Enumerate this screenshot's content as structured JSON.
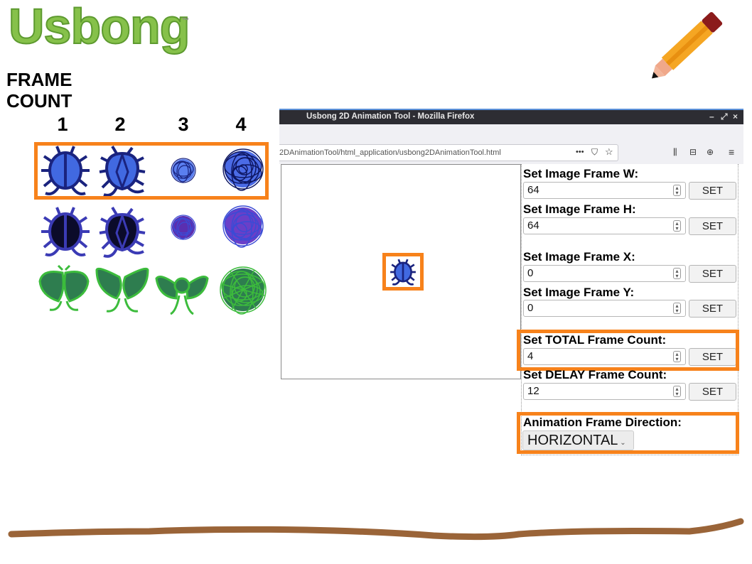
{
  "logo": {
    "text": "Usbong",
    "trademark": "™"
  },
  "heading": {
    "line1": "FRAME",
    "line2": "COUNT"
  },
  "frame_numbers": [
    "1",
    "2",
    "3",
    "4"
  ],
  "browser": {
    "title": "Usbong 2D Animation Tool - Mozilla Firefox",
    "window_controls": [
      "–",
      "⤢",
      "×"
    ],
    "url": "2DAnimationTool/html_application/usbong2DAnimationTool.html",
    "url_actions": [
      "•••",
      "⛉",
      "☆"
    ],
    "toolbar_icons": [
      "⫼",
      "⊟",
      "⊕",
      "≡"
    ]
  },
  "fields": [
    {
      "label": "Set Image Frame W:",
      "value": "64",
      "button": "SET"
    },
    {
      "label": "Set Image Frame H:",
      "value": "64",
      "button": "SET"
    },
    {
      "label": "Set Image Frame X:",
      "value": "0",
      "button": "SET"
    },
    {
      "label": "Set Image Frame Y:",
      "value": "0",
      "button": "SET"
    },
    {
      "label": "Set TOTAL Frame Count:",
      "value": "4",
      "button": "SET"
    },
    {
      "label": "Set DELAY Frame Count:",
      "value": "12",
      "button": "SET"
    }
  ],
  "direction": {
    "label": "Animation Frame Direction:",
    "selected": "HORIZONTAL"
  },
  "colors": {
    "accent": "#f7821b",
    "logo_green": "#86c14a",
    "underline_brown": "#9a6438",
    "beetle_blue": "#3f66e0",
    "leaf_green": "#2e7d4f"
  }
}
